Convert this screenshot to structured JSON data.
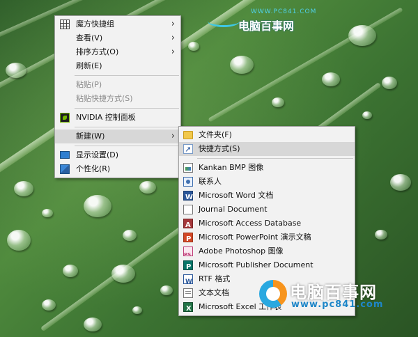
{
  "main_menu": {
    "items": [
      {
        "label": "魔方快捷组",
        "icon": "grid-icon",
        "submenu": true
      },
      {
        "label": "查看(V)",
        "submenu": true
      },
      {
        "label": "排序方式(O)",
        "submenu": true
      },
      {
        "label": "刷新(E)"
      },
      {
        "label": "粘贴(P)",
        "disabled": true
      },
      {
        "label": "粘贴快捷方式(S)",
        "disabled": true
      },
      {
        "label": "NVIDIA 控制面板",
        "icon": "nvidia-icon"
      },
      {
        "label": "新建(W)",
        "submenu": true,
        "highlighted": true
      },
      {
        "label": "显示设置(D)",
        "icon": "display-settings-icon"
      },
      {
        "label": "个性化(R)",
        "icon": "personalize-icon"
      }
    ]
  },
  "new_submenu": {
    "items": [
      {
        "label": "文件夹(F)",
        "icon": "folder-icon"
      },
      {
        "label": "快捷方式(S)",
        "icon": "shortcut-icon",
        "highlighted": true
      },
      {
        "label": "Kankan BMP 图像",
        "icon": "bmp-image-icon"
      },
      {
        "label": "联系人",
        "icon": "contact-icon"
      },
      {
        "label": "Microsoft Word 文档",
        "icon": "word-icon"
      },
      {
        "label": "Journal Document",
        "icon": "journal-icon"
      },
      {
        "label": "Microsoft Access Database",
        "icon": "access-icon"
      },
      {
        "label": "Microsoft PowerPoint 演示文稿",
        "icon": "powerpoint-icon"
      },
      {
        "label": "Adobe Photoshop 图像",
        "icon": "photoshop-icon"
      },
      {
        "label": "Microsoft Publisher Document",
        "icon": "publisher-icon"
      },
      {
        "label": "RTF 格式",
        "icon": "rtf-icon"
      },
      {
        "label": "文本文档",
        "icon": "text-document-icon"
      },
      {
        "label": "Microsoft Excel 工作表",
        "icon": "excel-icon"
      }
    ]
  },
  "watermark": {
    "top_url": "WWW.PC841.COM",
    "top_name": "电脑百事网",
    "bottom_name": "电脑百事网",
    "bottom_url": "www.pc841.com"
  },
  "colors": {
    "menu_bg": "#f2f2f2",
    "highlight": "#d7d7d7",
    "disabled_text": "#8a8a8a",
    "background_leaf": "#3c7332"
  }
}
